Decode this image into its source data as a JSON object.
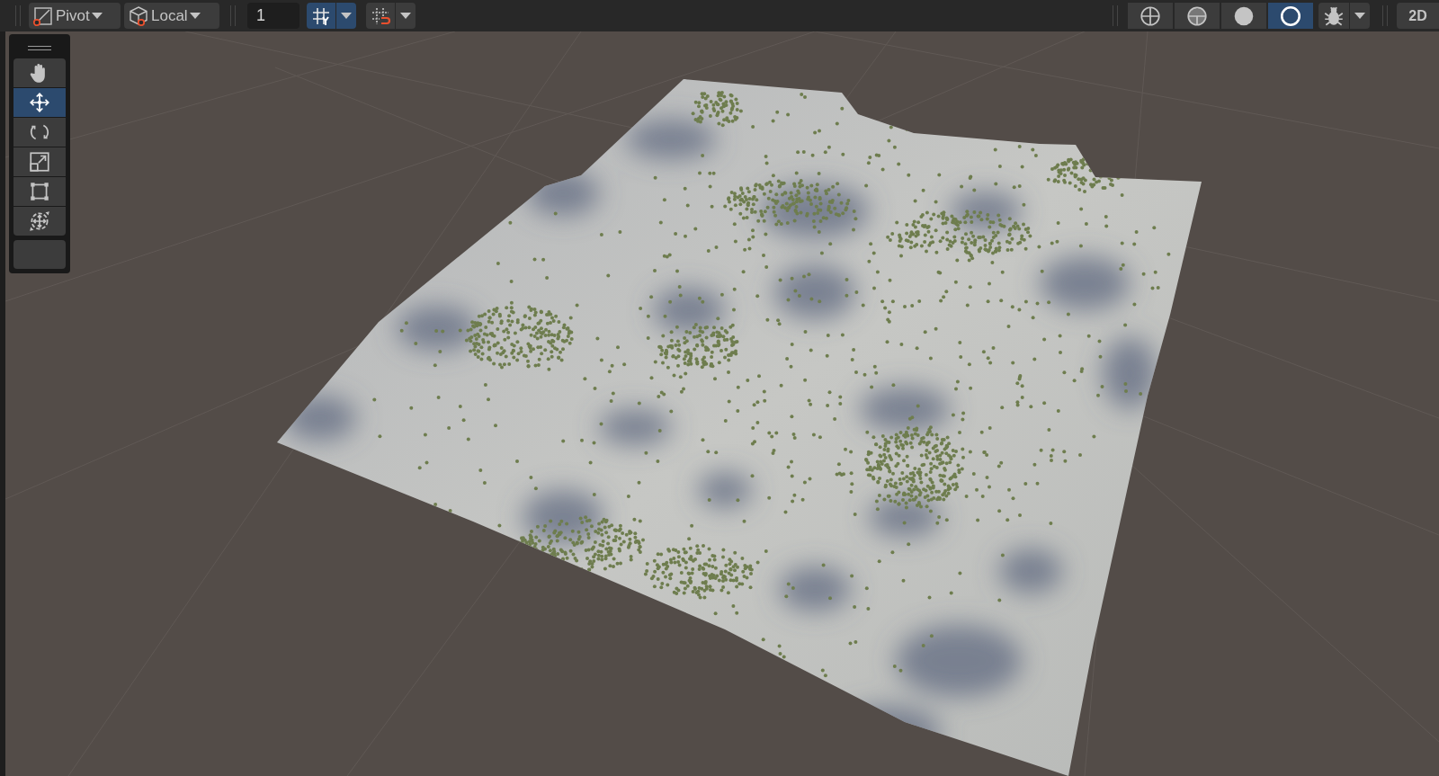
{
  "toolbar": {
    "pivot": {
      "label": "Pivot"
    },
    "space": {
      "label": "Local"
    },
    "snap_value": "1",
    "snap_buttons": [
      {
        "kind": "grid",
        "selected": true
      },
      {
        "kind": "increment",
        "selected": false
      }
    ],
    "draw_modes": [
      {
        "kind": "wireframe",
        "selected": false
      },
      {
        "kind": "shaded-wireframe",
        "selected": false
      },
      {
        "kind": "shaded",
        "selected": false
      },
      {
        "kind": "lighting",
        "selected": true
      }
    ],
    "gizmos": {
      "selected": false
    },
    "mode_2d": {
      "label": "2D",
      "selected": false
    }
  },
  "tools": [
    {
      "kind": "hand",
      "selected": false
    },
    {
      "kind": "move",
      "selected": true
    },
    {
      "kind": "rotate",
      "selected": false
    },
    {
      "kind": "scale",
      "selected": false
    },
    {
      "kind": "rect",
      "selected": false
    },
    {
      "kind": "transform",
      "selected": false
    }
  ]
}
